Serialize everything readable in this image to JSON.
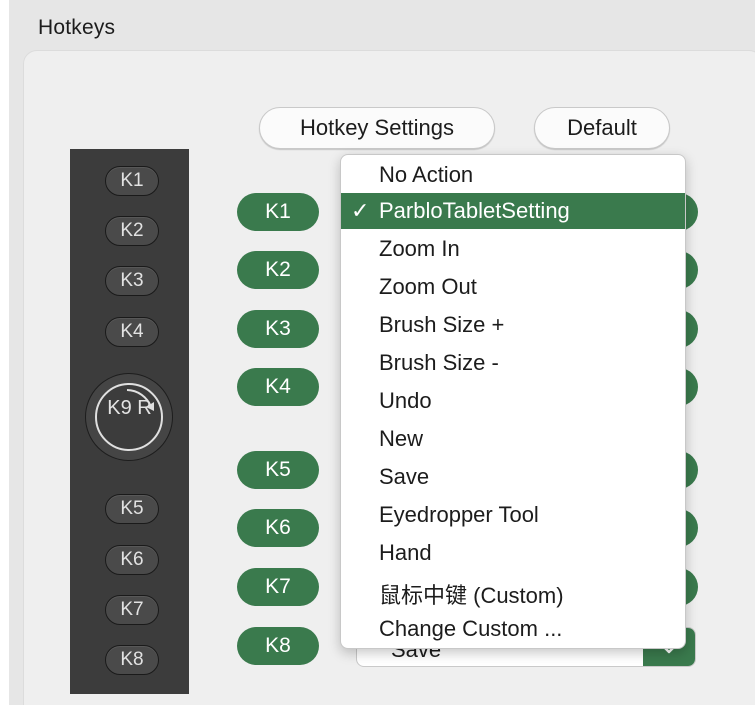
{
  "section": {
    "title": "Hotkeys"
  },
  "buttons": {
    "hotkey_settings": "Hotkey Settings",
    "default": "Default"
  },
  "device": {
    "keys": [
      "K1",
      "K2",
      "K3",
      "K4",
      "K5",
      "K6",
      "K7",
      "K8"
    ],
    "dial": {
      "label": "K9",
      "suffix": "R"
    }
  },
  "key_rows": [
    "K1",
    "K2",
    "K3",
    "K4",
    "K5",
    "K6",
    "K7",
    "K8"
  ],
  "select": {
    "value": "Save"
  },
  "menu": {
    "check_glyph": "✓",
    "selected_index": 1,
    "items": [
      "No Action",
      "ParbloTabletSetting",
      "Zoom In",
      "Zoom Out",
      "Brush Size +",
      "Brush Size -",
      "Undo",
      "New",
      "Save",
      "Eyedropper Tool",
      "Hand",
      "鼠标中键 (Custom)",
      "Change Custom ..."
    ]
  },
  "colors": {
    "accent": "#3a7a4d",
    "device": "#3c3c3c",
    "background": "#e6e6e6"
  },
  "icons": {
    "dial": "rotate-arrow-icon",
    "select": "chevron-down-icon",
    "check": "checkmark-icon"
  }
}
